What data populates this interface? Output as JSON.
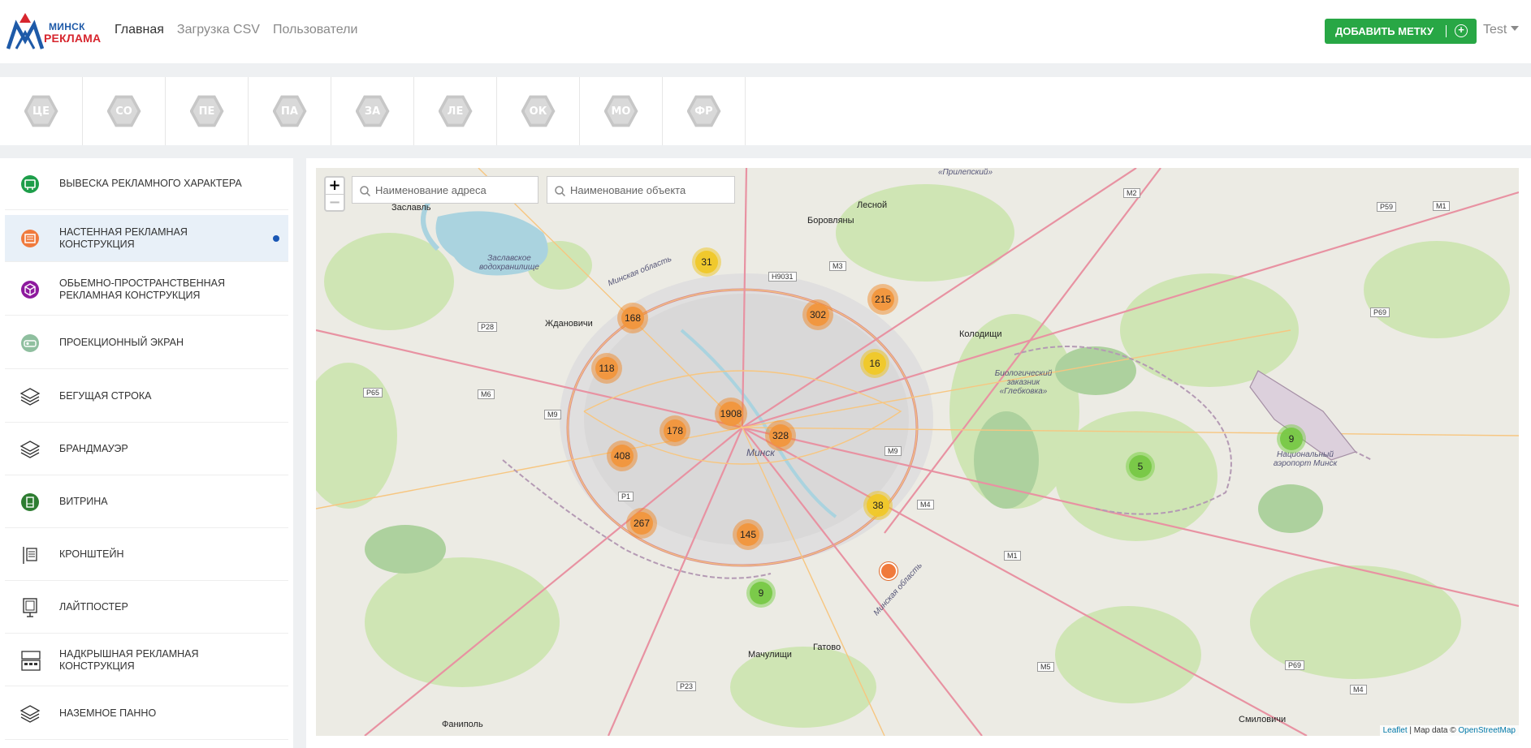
{
  "logo": {
    "line1": "МИНСК",
    "line2": "РЕКЛАМА"
  },
  "nav": {
    "home": "Главная",
    "csv": "Загрузка CSV",
    "users": "Пользователи"
  },
  "add_button": {
    "label": "ДОБАВИТЬ МЕТКУ",
    "icon": "plus-circle-icon"
  },
  "user": {
    "name": "Test"
  },
  "categories": [
    "ЦЕ",
    "СО",
    "ПЕ",
    "ПА",
    "ЗА",
    "ЛЕ",
    "ОК",
    "МО",
    "ФР"
  ],
  "sidebar": {
    "items": [
      {
        "label": "ВЫВЕСКА РЕКЛАМНОГО ХАРАКТЕРА",
        "label2": "",
        "icon": "sign-icon",
        "color": "#1e9e4a"
      },
      {
        "label": "НАСТЕННАЯ РЕКЛАМНАЯ",
        "label2": "КОНСТРУКЦИЯ",
        "icon": "wall-billboard-icon",
        "color": "#f07a3c",
        "active": true
      },
      {
        "label": "ОБЬЕМНО-ПРОСТРАНСТВЕННАЯ",
        "label2": "РЕКЛАМНАЯ КОНСТРУКЦИЯ",
        "icon": "cube-icon",
        "color": "#8e1a9e"
      },
      {
        "label": "ПРОЕКЦИОННЫЙ ЭКРАН",
        "label2": "",
        "icon": "projector-icon",
        "color": "#8fbf9f"
      },
      {
        "label": "БЕГУЩАЯ СТРОКА",
        "label2": "",
        "icon": "layers-icon",
        "color": "#333333"
      },
      {
        "label": "БРАНДМАУЭР",
        "label2": "",
        "icon": "layers-icon",
        "color": "#333333"
      },
      {
        "label": "ВИТРИНА",
        "label2": "",
        "icon": "showcase-icon",
        "color": "#2e7d32"
      },
      {
        "label": "КРОНШТЕЙН",
        "label2": "",
        "icon": "bracket-icon",
        "color": "#333333"
      },
      {
        "label": "ЛАЙТПОСТЕР",
        "label2": "",
        "icon": "lightposter-icon",
        "color": "#333333"
      },
      {
        "label": "НАДКРЫШНАЯ РЕКЛАМНАЯ",
        "label2": "КОНСТРУКЦИЯ",
        "icon": "rooftop-icon",
        "color": "#333333"
      },
      {
        "label": "НАЗЕМНОЕ ПАННО",
        "label2": "",
        "icon": "layers-icon",
        "color": "#333333"
      }
    ]
  },
  "map": {
    "search_address_placeholder": "Наименование адреса",
    "search_object_placeholder": "Наименование объекта",
    "zoom_in": "+",
    "zoom_out": "−",
    "clusters": [
      "31",
      "168",
      "302",
      "215",
      "118",
      "1908",
      "16",
      "178",
      "328",
      "408",
      "267",
      "145",
      "38",
      "9",
      "5",
      "9"
    ],
    "places": [
      "«Прилепский»",
      "Заславль",
      "Лесной",
      "Боровляны",
      "Заславское водохранилище",
      "Минская область",
      "Ждановичи",
      "Колодищи",
      "Биологический заказник «Глебковка»",
      "Минск",
      "Национальный аэропорт Минск",
      "Мачулищи",
      "Гатово",
      "Минская область",
      "Фаниполь",
      "Смиловичи"
    ],
    "roads": [
      "M2",
      "P59",
      "M1",
      "H9031",
      "M3",
      "P28",
      "P69",
      "P65",
      "M6",
      "M9",
      "M9",
      "M4",
      "P1",
      "M1",
      "P23",
      "M5",
      "P69",
      "M4"
    ],
    "attribution": {
      "leaflet": "Leaflet",
      "sep": " | Map data © ",
      "osm": "OpenStreetMap"
    }
  }
}
